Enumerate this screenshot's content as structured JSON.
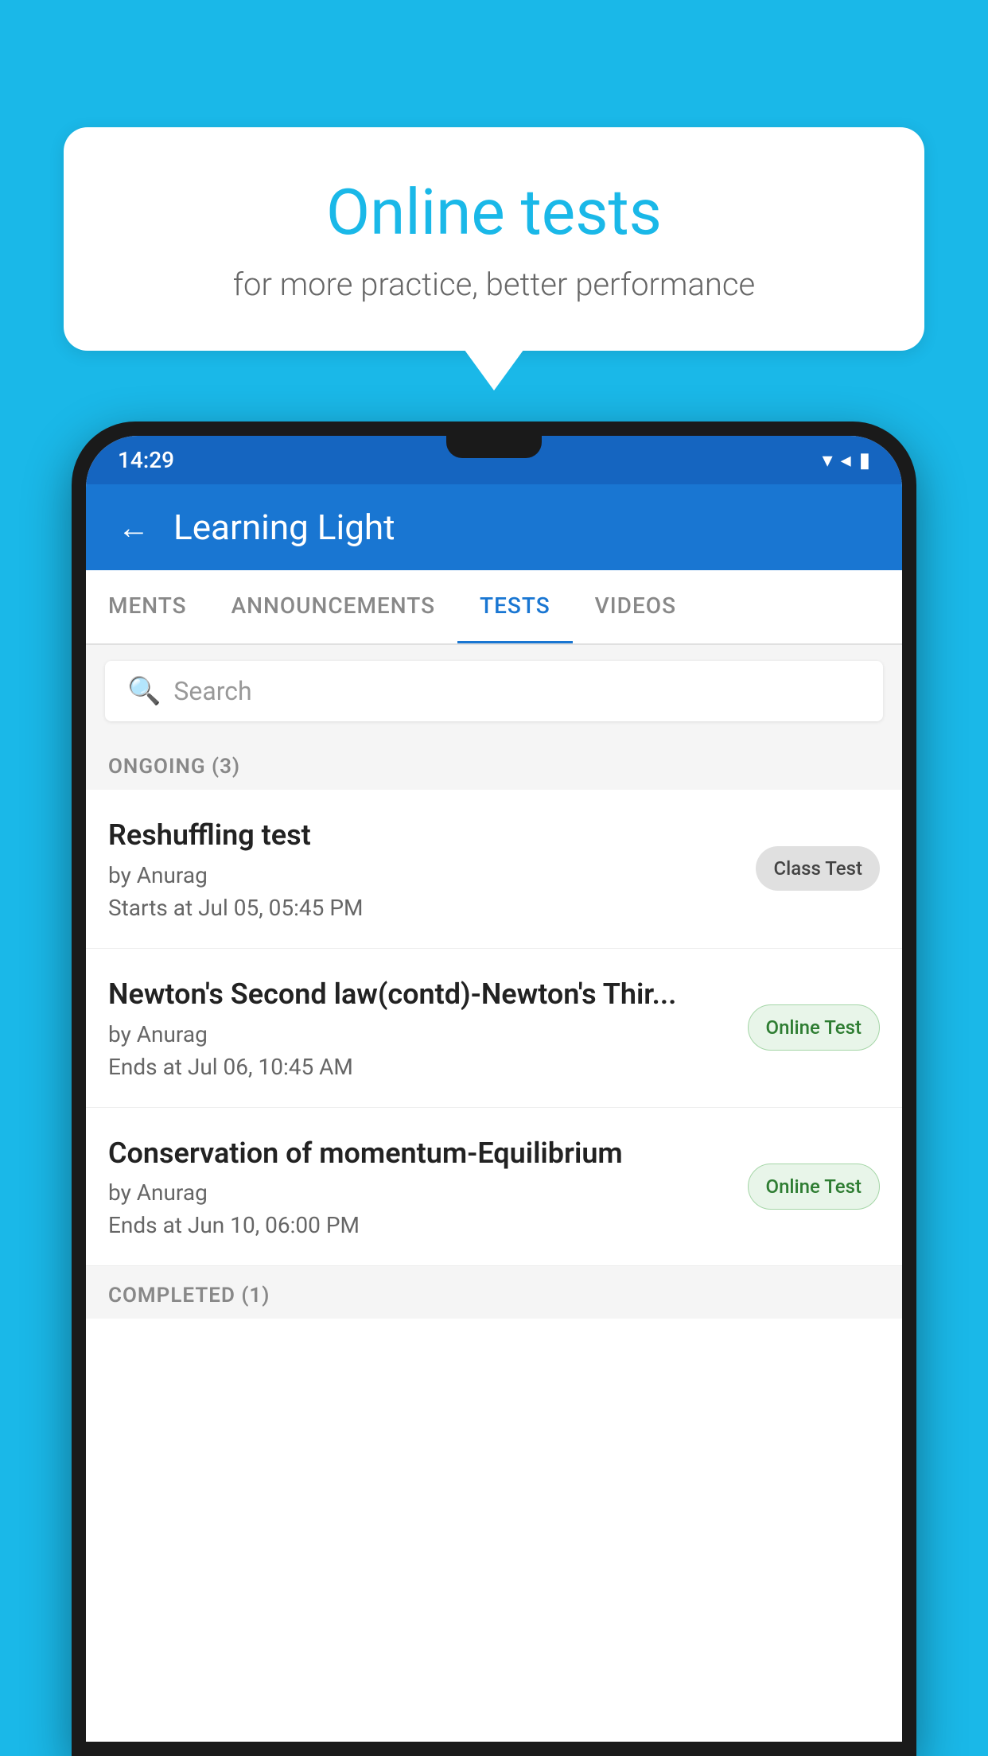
{
  "background": {
    "color": "#1ab8e8"
  },
  "speech_bubble": {
    "title": "Online tests",
    "subtitle": "for more practice, better performance"
  },
  "phone": {
    "status_bar": {
      "time": "14:29",
      "wifi": "▼",
      "signal": "▲",
      "battery": "▐"
    },
    "header": {
      "title": "Learning Light",
      "back_label": "←"
    },
    "tabs": [
      {
        "label": "MENTS",
        "active": false
      },
      {
        "label": "ANNOUNCEMENTS",
        "active": false
      },
      {
        "label": "TESTS",
        "active": true
      },
      {
        "label": "VIDEOS",
        "active": false
      }
    ],
    "search": {
      "placeholder": "Search"
    },
    "ongoing_section": {
      "label": "ONGOING (3)"
    },
    "tests": [
      {
        "name": "Reshuffling test",
        "author": "by Anurag",
        "date_label": "Starts at",
        "date": "Jul 05, 05:45 PM",
        "badge": "Class Test",
        "badge_type": "class"
      },
      {
        "name": "Newton's Second law(contd)-Newton's Thir...",
        "author": "by Anurag",
        "date_label": "Ends at",
        "date": "Jul 06, 10:45 AM",
        "badge": "Online Test",
        "badge_type": "online"
      },
      {
        "name": "Conservation of momentum-Equilibrium",
        "author": "by Anurag",
        "date_label": "Ends at",
        "date": "Jun 10, 06:00 PM",
        "badge": "Online Test",
        "badge_type": "online"
      }
    ],
    "completed_section": {
      "label": "COMPLETED (1)"
    }
  }
}
